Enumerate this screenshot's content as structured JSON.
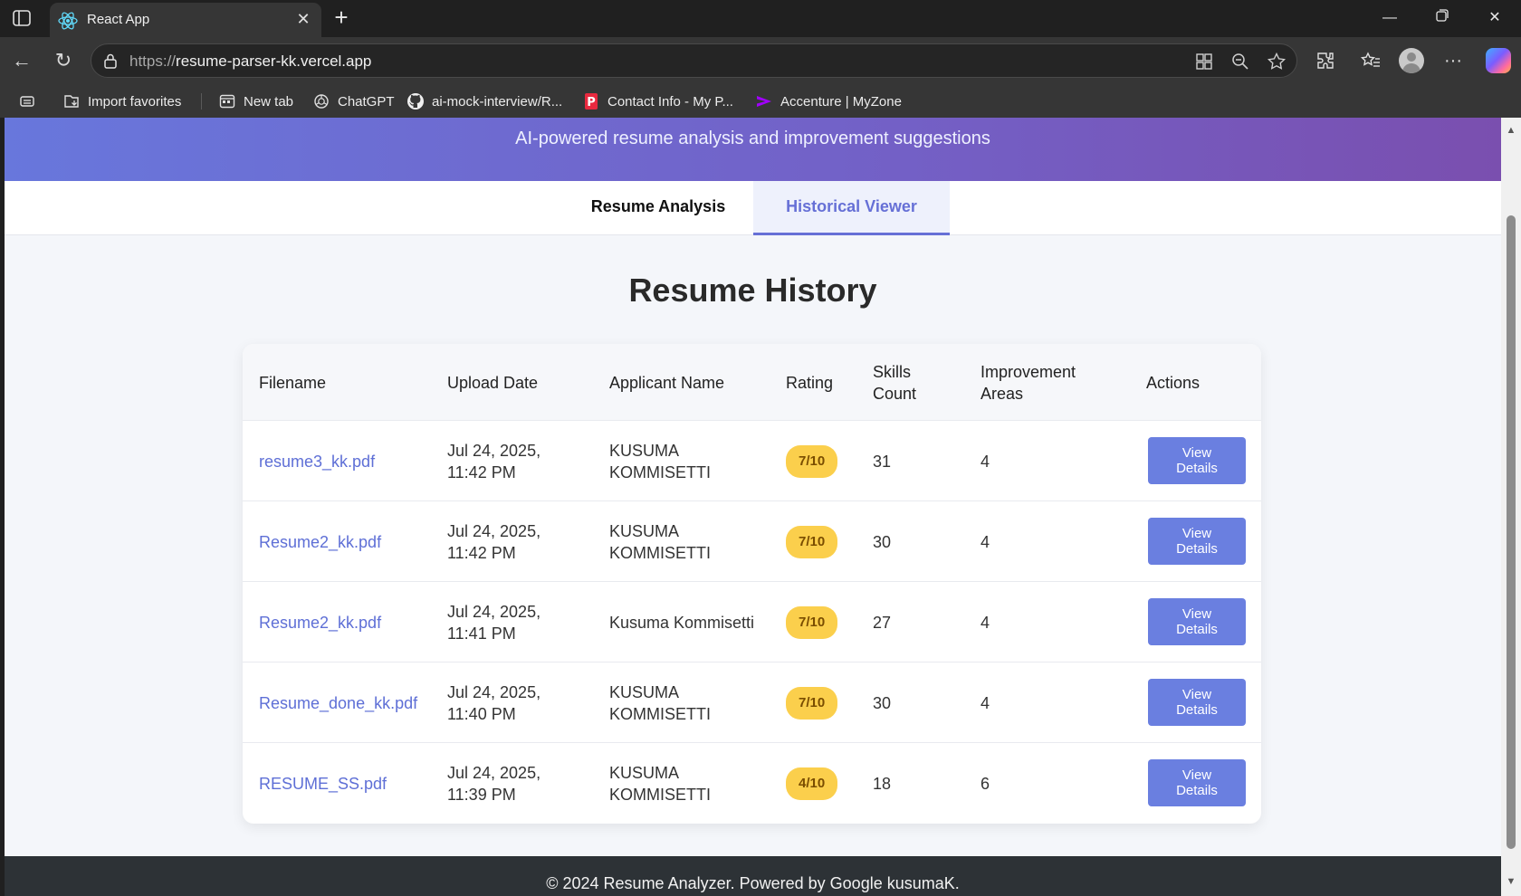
{
  "browser": {
    "tab_title": "React App",
    "url_scheme": "https://",
    "url_host": "resume-parser-kk.vercel.app",
    "favorites": [
      {
        "label": "Import favorites",
        "icon": "import-favorites-icon"
      },
      {
        "label": "New tab",
        "icon": "new-tab-icon"
      },
      {
        "label": "ChatGPT",
        "icon": "chatgpt-icon"
      },
      {
        "label": "ai-mock-interview/R...",
        "icon": "github-icon"
      },
      {
        "label": "Contact Info - My P...",
        "icon": "p-logo-icon"
      },
      {
        "label": "Accenture | MyZone",
        "icon": "accenture-icon"
      }
    ]
  },
  "app": {
    "subtitle": "AI-powered resume analysis and improvement suggestions",
    "tabs": [
      {
        "label": "Resume Analysis",
        "active": false
      },
      {
        "label": "Historical Viewer",
        "active": true
      }
    ],
    "page_title": "Resume History",
    "table": {
      "headers": [
        "Filename",
        "Upload Date",
        "Applicant Name",
        "Rating",
        "Skills Count",
        "Improvement Areas",
        "Actions"
      ],
      "rows": [
        {
          "filename": "resume3_kk.pdf",
          "date": "Jul 24, 2025, 11:42 PM",
          "applicant": "KUSUMA KOMMISETTI",
          "rating": "7/10",
          "skills": "31",
          "improvements": "4",
          "action": "View Details"
        },
        {
          "filename": "Resume2_kk.pdf",
          "date": "Jul 24, 2025, 11:42 PM",
          "applicant": "KUSUMA KOMMISETTI",
          "rating": "7/10",
          "skills": "30",
          "improvements": "4",
          "action": "View Details"
        },
        {
          "filename": "Resume2_kk.pdf",
          "date": "Jul 24, 2025, 11:41 PM",
          "applicant": "Kusuma Kommisetti",
          "rating": "7/10",
          "skills": "27",
          "improvements": "4",
          "action": "View Details"
        },
        {
          "filename": "Resume_done_kk.pdf",
          "date": "Jul 24, 2025, 11:40 PM",
          "applicant": "KUSUMA KOMMISETTI",
          "rating": "7/10",
          "skills": "30",
          "improvements": "4",
          "action": "View Details"
        },
        {
          "filename": "RESUME_SS.pdf",
          "date": "Jul 24, 2025, 11:39 PM",
          "applicant": "KUSUMA KOMMISETTI",
          "rating": "4/10",
          "skills": "18",
          "improvements": "6",
          "action": "View Details"
        }
      ]
    },
    "footer": "© 2024 Resume Analyzer. Powered by Google kusumaK."
  },
  "colors": {
    "accent": "#6670d6",
    "rating_badge": "#fbcf4c",
    "button": "#6a7fe0",
    "hero_start": "#6877dc",
    "hero_end": "#7a4faf"
  }
}
